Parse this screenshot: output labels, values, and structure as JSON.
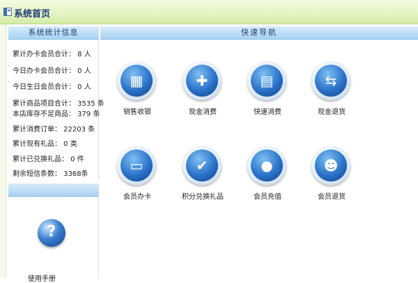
{
  "window": {
    "title": "系统首页"
  },
  "stats": {
    "header": "系统统计信息",
    "items": [
      "累计办卡会员合计： 8 人",
      "今日办卡会员合计： 0 人",
      "今日生日会员合计： 0 人",
      "累计商品项目合计： 3535 条",
      "本店库存不足商品： 379 条",
      "累计消费订单： 22203 条",
      "累计现有礼品： 0 类",
      "累计已兑换礼品： 0 件",
      "剩余短信条数： 3368条"
    ]
  },
  "help": {
    "label": "使用手册",
    "icon": "question-icon"
  },
  "nav": {
    "header": "快速导航",
    "items": [
      {
        "label": "销售收银",
        "icon": "cash-register-icon"
      },
      {
        "label": "现金消费",
        "icon": "gift-box-icon"
      },
      {
        "label": "快速消费",
        "icon": "card-stack-icon"
      },
      {
        "label": "现金退货",
        "icon": "return-cards-icon"
      },
      {
        "label": "会员办卡",
        "icon": "member-card-icon"
      },
      {
        "label": "积分兑换礼品",
        "icon": "gift-exchange-icon"
      },
      {
        "label": "会员充值",
        "icon": "coins-icon"
      },
      {
        "label": "会员退货",
        "icon": "member-return-icon"
      }
    ]
  }
}
